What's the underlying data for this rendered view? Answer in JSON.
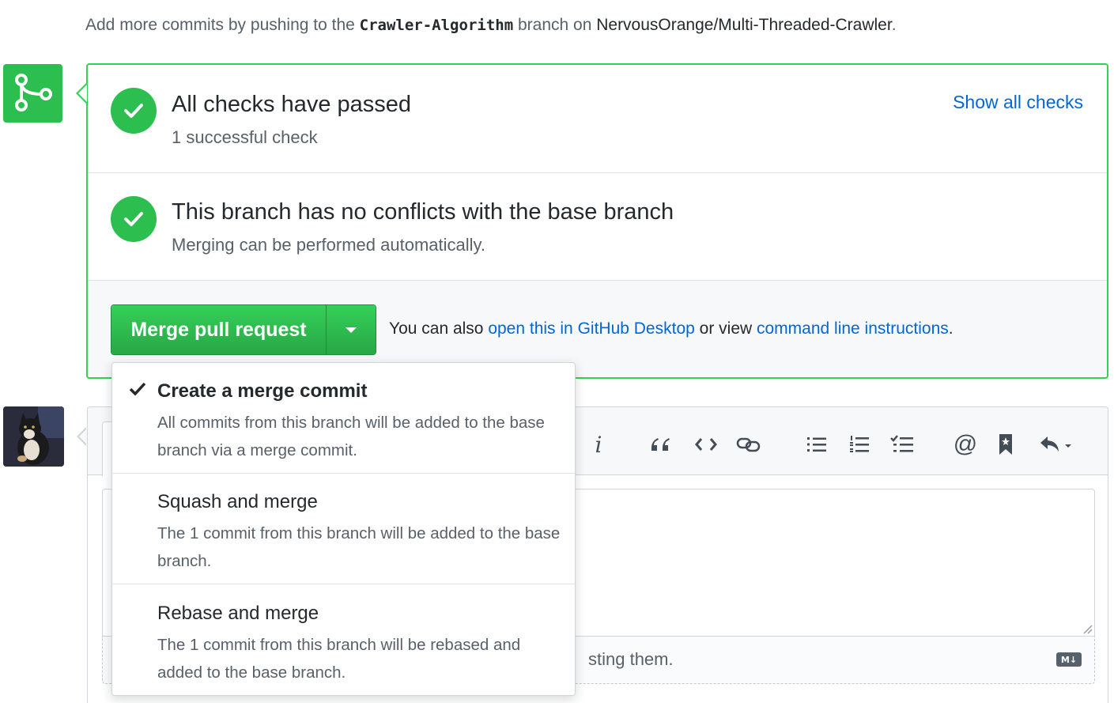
{
  "hint": {
    "prefix": "Add more commits by pushing to the ",
    "branch": "Crawler-Algorithm",
    "middle": " branch on ",
    "repo": "NervousOrange/Multi-Threaded-Crawler",
    "suffix": "."
  },
  "checks": {
    "title": "All checks have passed",
    "subtitle": "1 successful check",
    "show_all": "Show all checks"
  },
  "conflicts": {
    "title": "This branch has no conflicts with the base branch",
    "subtitle": "Merging can be performed automatically."
  },
  "merge": {
    "button_label": "Merge pull request",
    "also_prefix": "You can also ",
    "desktop_link": "open this in GitHub Desktop",
    "also_middle": " or view ",
    "cli_link": "command line instructions",
    "also_suffix": "."
  },
  "merge_options": [
    {
      "title": "Create a merge commit",
      "description": "All commits from this branch will be added to the base branch via a merge commit.",
      "selected": true
    },
    {
      "title": "Squash and merge",
      "description": "The 1 commit from this branch will be added to the base branch.",
      "selected": false
    },
    {
      "title": "Rebase and merge",
      "description": "The 1 commit from this branch will be rebased and added to the base branch.",
      "selected": false
    }
  ],
  "editor": {
    "footer_visible_text": "sting them.",
    "markdown_badge": "M↓",
    "toolbar": [
      "italic-icon",
      "quote-icon",
      "code-icon",
      "link-icon",
      "bulleted-list-icon",
      "numbered-list-icon",
      "task-list-icon",
      "mention-icon",
      "bookmark-icon",
      "reply-icon"
    ]
  },
  "colors": {
    "success": "#2cbe4e",
    "border_success": "#34d058",
    "link": "#0366d6",
    "text": "#24292e",
    "muted": "#586069"
  }
}
